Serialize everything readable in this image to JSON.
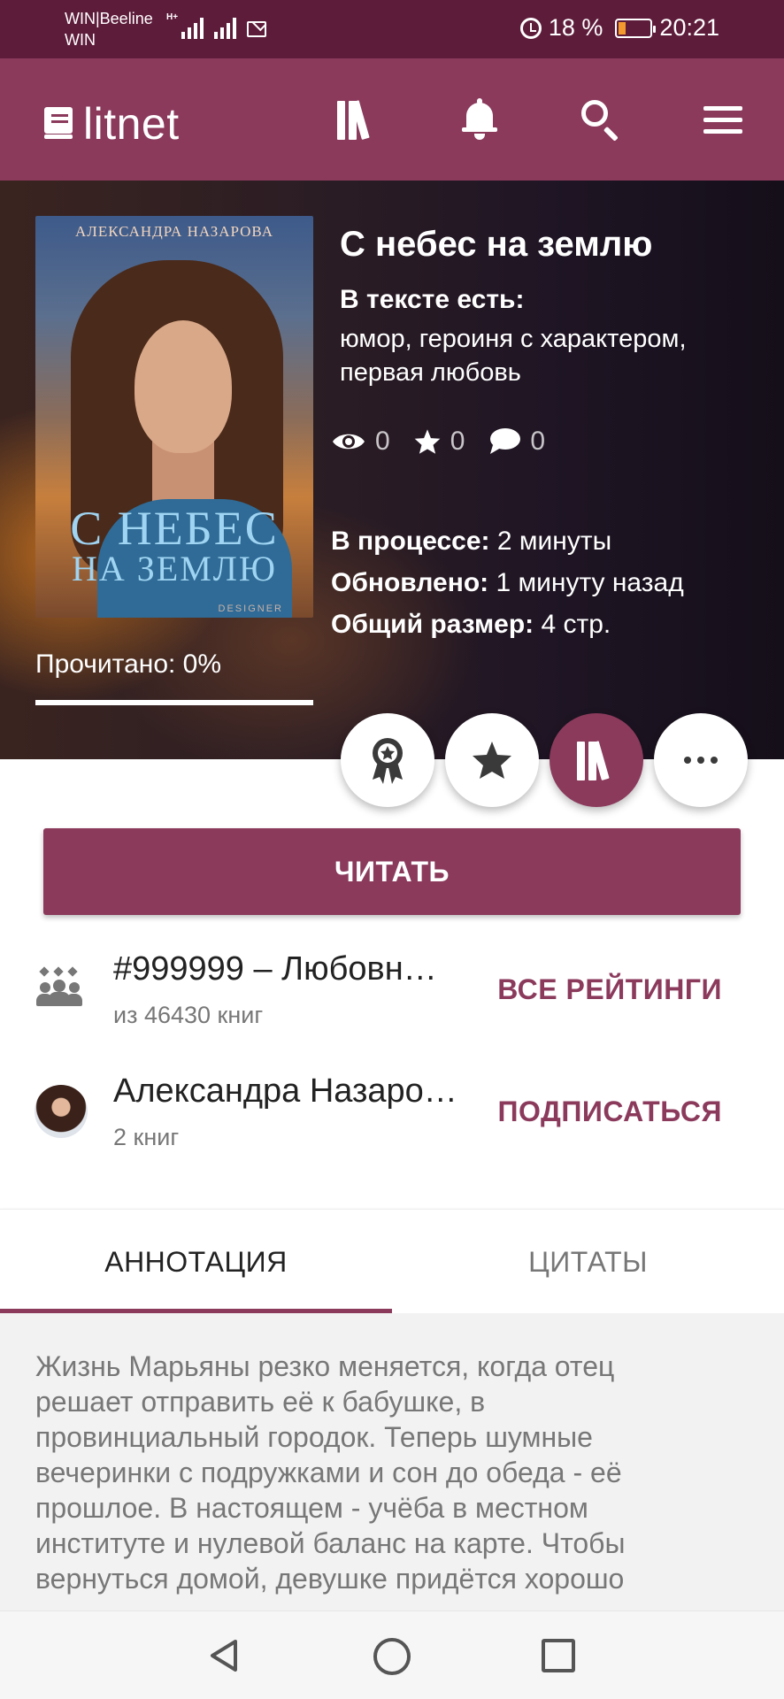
{
  "status_bar": {
    "carrier_line1": "WIN|Beeline",
    "carrier_line2": "WIN",
    "network_type": "H+",
    "battery_percent": "18 %",
    "battery_level": 0.18,
    "time": "20:21",
    "icons": [
      "signal-icon",
      "mail-icon",
      "alarm-icon",
      "battery-icon"
    ]
  },
  "appbar": {
    "logo_text": "litnet",
    "icons": [
      "logo-book-icon",
      "library-icon",
      "bell-icon",
      "search-icon",
      "menu-icon"
    ]
  },
  "book": {
    "cover": {
      "author_text": "АЛЕКСАНДРА НАЗАРОВА",
      "title_line1": "С НЕБЕС",
      "title_line2": "НА ЗЕМЛЮ",
      "designer_text": "DESIGNER"
    },
    "title": "С небес на землю",
    "tags_label": "В тексте есть:",
    "tags_text": "юмор, героиня с характером, первая любовь",
    "stats": {
      "views": "0",
      "rating": "0",
      "comments": "0"
    },
    "meta": {
      "in_progress_label": "В процессе:",
      "in_progress_value": "2 минуты",
      "updated_label": "Обновлено:",
      "updated_value": "1 минуту назад",
      "size_label": "Общий размер:",
      "size_value": "4 стр."
    },
    "read_progress_label": "Прочитано: 0%",
    "read_progress": 0
  },
  "actions": {
    "buttons": [
      "award-icon",
      "star-icon",
      "library-icon",
      "more-icon"
    ],
    "active_color": "#8b3a5c"
  },
  "read_button": "ЧИТАТЬ",
  "ranking": {
    "title": "#999999 – Любовн…",
    "subtitle": "из 46430 книг",
    "action": "ВСЕ РЕЙТИНГИ"
  },
  "author": {
    "name": "Александра Назаро…",
    "books": "2 книг",
    "action": "ПОДПИСАТЬСЯ"
  },
  "tabs": [
    {
      "label": "АННОТАЦИЯ",
      "active": true
    },
    {
      "label": "ЦИТАТЫ",
      "active": false
    }
  ],
  "annotation": "Жизнь Марьяны резко меняется, когда отец решает отправить её к бабушке, в провинциальный городок. Теперь шумные вечеринки с подружками и сон до обеда - её прошлое. В настоящем - учёба в местном институте и нулевой баланс на карте. Чтобы вернуться домой, девушке придётся хорошо",
  "colors": {
    "status_bar": "#5e1c3b",
    "brand": "#8b3a5c",
    "battery_warning": "#f29a2e"
  },
  "navbar": {
    "icons": [
      "back-icon",
      "home-icon",
      "recent-apps-icon"
    ]
  }
}
